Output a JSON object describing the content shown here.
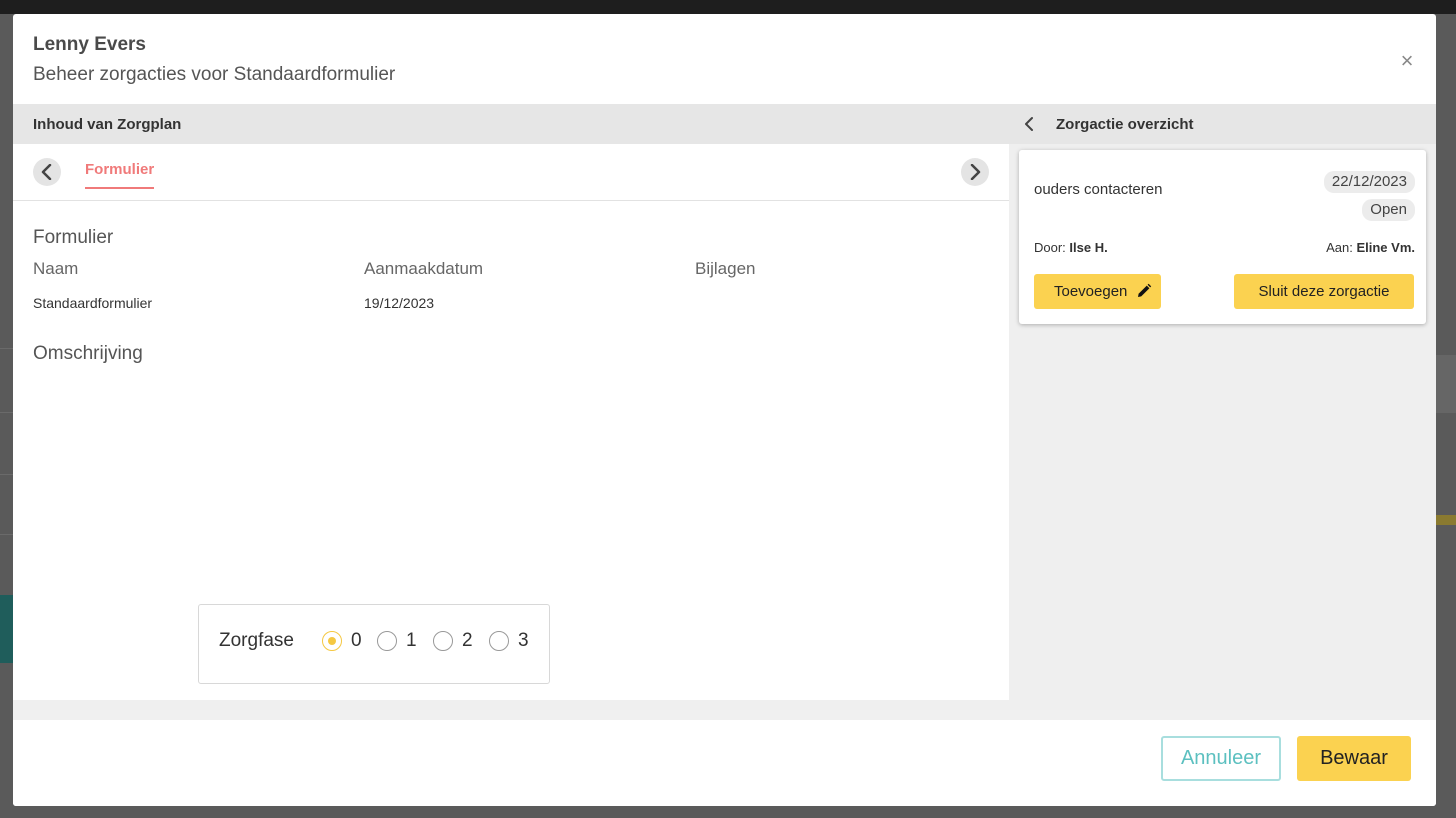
{
  "modal": {
    "title": "Lenny Evers",
    "subtitle": "Beheer zorgacties voor Standaardformulier",
    "close_glyph": "×"
  },
  "left_panel": {
    "header": "Inhoud van Zorgplan",
    "tabs": [
      {
        "label": "Formulier",
        "active": true
      }
    ],
    "section_title": "Formulier",
    "columns": [
      {
        "label": "Naam",
        "value": "Standaardformulier"
      },
      {
        "label": "Aanmaakdatum",
        "value": "19/12/2023"
      },
      {
        "label": "Bijlagen",
        "value": ""
      }
    ],
    "description_title": "Omschrijving",
    "zorgfase": {
      "label": "Zorgfase",
      "options": [
        "0",
        "1",
        "2",
        "3"
      ],
      "selected": "0"
    }
  },
  "right_panel": {
    "header": "Zorgactie overzicht",
    "card": {
      "title": "ouders contacteren",
      "date": "22/12/2023",
      "status": "Open",
      "by_label": "Door:",
      "by_value": "Ilse H.",
      "to_label": "Aan:",
      "to_value": "Eline Vm.",
      "add_button": "Toevoegen",
      "close_button": "Sluit deze zorgactie"
    }
  },
  "footer": {
    "cancel_button": "Annuleer",
    "save_button": "Bewaar"
  },
  "colors": {
    "accent_yellow": "#fbd250",
    "tab_active": "#f07a7a",
    "cancel_teal": "#5cc0c0"
  },
  "icons": {
    "close": "close-icon",
    "prev": "chevron-left-icon",
    "next": "chevron-right-icon",
    "back": "chevron-left-icon",
    "edit": "pencil-icon"
  }
}
